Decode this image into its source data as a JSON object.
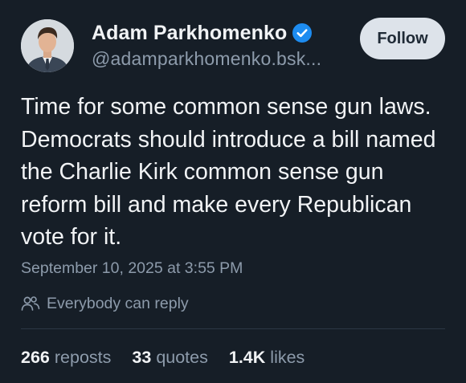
{
  "author": {
    "display_name": "Adam Parkhomenko",
    "handle": "@adamparkhomenko.bsk...",
    "verified": true,
    "verified_color": "#1d8cf0"
  },
  "actions": {
    "follow_label": "Follow"
  },
  "post": {
    "text": "Time for some common sense gun laws. Democrats should introduce a bill named the Charlie Kirk common sense gun reform bill and make every Republican vote for it.",
    "timestamp": "September 10, 2025 at 3:55 PM",
    "reply_setting": "Everybody can reply"
  },
  "stats": {
    "reposts_count": "266",
    "reposts_label": "reposts",
    "quotes_count": "33",
    "quotes_label": "quotes",
    "likes_count": "1.4K",
    "likes_label": "likes"
  },
  "colors": {
    "background": "#161e27",
    "text_primary": "#f1f3f5",
    "text_secondary": "#8d9bab",
    "follow_button_bg": "#dde3ea"
  },
  "icons": {
    "verified": "verified-check-icon",
    "reply_setting": "people-icon"
  }
}
